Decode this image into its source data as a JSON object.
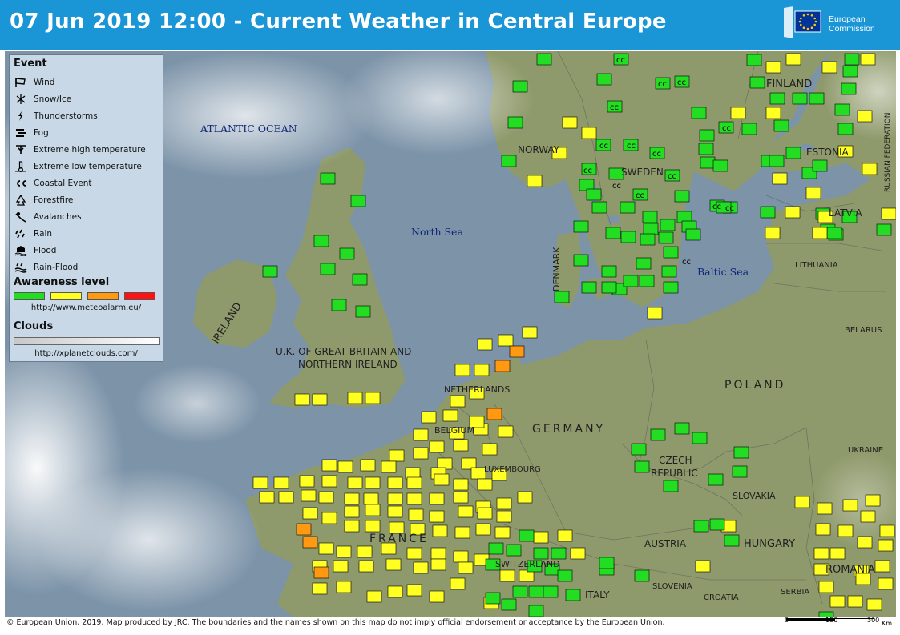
{
  "header": {
    "title": "07 Jun 2019 12:00 - Current Weather in Central Europe",
    "logo_line1": "European",
    "logo_line2": "Commission"
  },
  "legend": {
    "event_heading": "Event",
    "events": [
      {
        "label": "Wind",
        "icon": "wind-icon"
      },
      {
        "label": "Snow/Ice",
        "icon": "snow-ice-icon"
      },
      {
        "label": "Thunderstorms",
        "icon": "thunderstorm-icon"
      },
      {
        "label": "Fog",
        "icon": "fog-icon"
      },
      {
        "label": "Extreme high temperature",
        "icon": "high-temperature-icon"
      },
      {
        "label": "Extreme low temperature",
        "icon": "low-temperature-icon"
      },
      {
        "label": "Coastal Event",
        "icon": "coastal-event-icon"
      },
      {
        "label": "Forestfire",
        "icon": "forestfire-icon"
      },
      {
        "label": "Avalanches",
        "icon": "avalanche-icon"
      },
      {
        "label": "Rain",
        "icon": "rain-icon"
      },
      {
        "label": "Flood",
        "icon": "flood-icon"
      },
      {
        "label": "Rain-Flood",
        "icon": "rain-flood-icon"
      }
    ],
    "awareness_heading": "Awareness level",
    "awareness_colors": [
      "#22dd22",
      "#ffff22",
      "#ff9911",
      "#ff1111"
    ],
    "awareness_url": "http://www.meteoalarm.eu/",
    "clouds_heading": "Clouds",
    "clouds_url": "http://xplanetclouds.com/"
  },
  "map_labels": {
    "atlantic": "ATLANTIC OCEAN",
    "north_sea": "North Sea",
    "baltic_sea": "Baltic Sea",
    "finland": "FINLAND",
    "norway": "NORWAY",
    "sweden": "SWEDEN",
    "estonia": "ESTONIA",
    "latvia": "LATVIA",
    "lithuania": "LITHUANIA",
    "russia": "RUSSIAN FEDERATION",
    "belarus": "BELARUS",
    "denmark": "DENMARK",
    "ireland": "IRELAND",
    "uk_line1": "U.K. OF GREAT BRITAIN AND",
    "uk_line2": "NORTHERN IRELAND",
    "netherlands": "NETHERLANDS",
    "belgium": "BELGIUM",
    "luxembourg": "LUXEMBOURG",
    "germany": "GERMANY",
    "poland": "POLAND",
    "czech_line1": "CZECH",
    "czech_line2": "REPUBLIC",
    "slovakia": "SLOVAKIA",
    "ukraine": "UKRAINE",
    "france": "FRANCE",
    "switzerland": "SWITZERLAND",
    "austria": "AUSTRIA",
    "hungary": "HUNGARY",
    "romania": "ROMANIA",
    "slovenia": "SLOVENIA",
    "croatia": "CROATIA",
    "serbia": "SERBIA",
    "italy": "ITALY"
  },
  "colors": {
    "header": "#1a95d6",
    "sea": "#7c93a8",
    "land": "#8f9a6c",
    "green": "#22dd22",
    "yellow": "#ffff22",
    "orange": "#ff9911"
  },
  "footer": {
    "text": "© European Union, 2019. Map produced by JRC. The boundaries and the names shown on this map do not imply official endorsement or acceptance by the European Union."
  },
  "scale": {
    "t0": "0",
    "t1": "150",
    "t2": "300",
    "unit": "Km"
  }
}
